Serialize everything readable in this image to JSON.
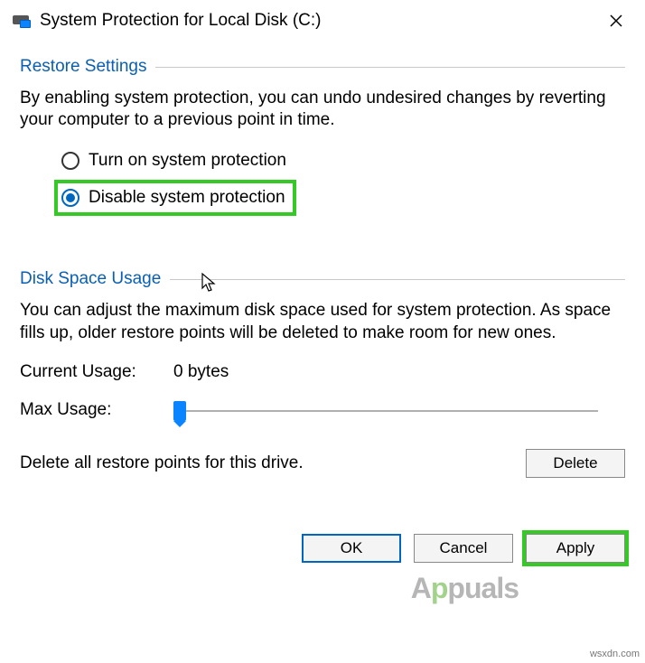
{
  "title": "System Protection for Local Disk (C:)",
  "restore": {
    "legend": "Restore Settings",
    "desc": "By enabling system protection, you can undo undesired changes by reverting your computer to a previous point in time.",
    "turn_on_label": "Turn on system protection",
    "disable_label": "Disable system protection"
  },
  "disk": {
    "legend": "Disk Space Usage",
    "desc": "You can adjust the maximum disk space used for system protection. As space fills up, older restore points will be deleted to make room for new ones.",
    "current_label": "Current Usage:",
    "current_value": "0 bytes",
    "max_label": "Max Usage:"
  },
  "delete": {
    "desc": "Delete all restore points for this drive.",
    "button": "Delete"
  },
  "buttons": {
    "ok": "OK",
    "cancel": "Cancel",
    "apply": "Apply"
  },
  "watermark": "Appuals",
  "source": "wsxdn.com"
}
